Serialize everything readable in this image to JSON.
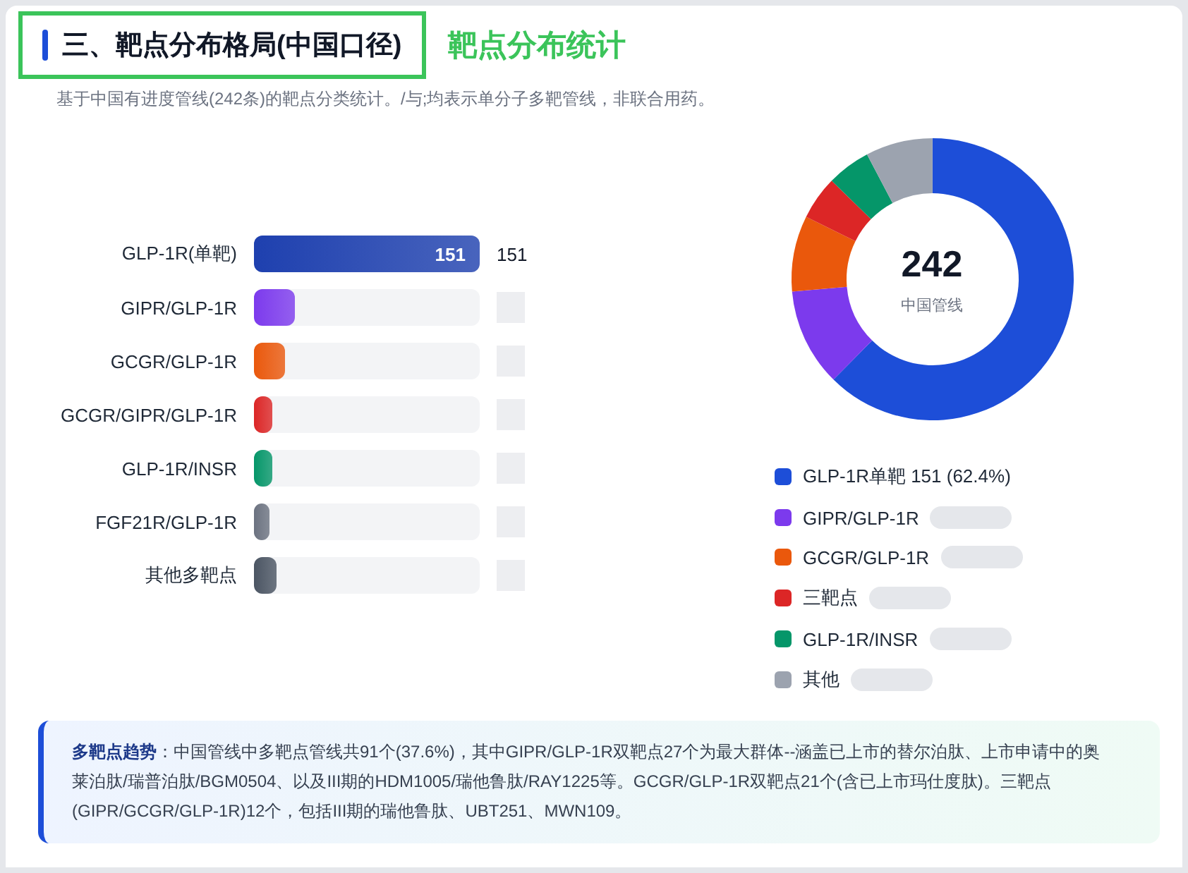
{
  "section": {
    "title": "三、靶点分布格局(中国口径)",
    "annotation": "靶点分布统计",
    "subtitle": "基于中国有进度管线(242条)的靶点分类统计。/与;均表示单分子多靶管线，非联合用药。"
  },
  "bars": [
    {
      "label": "GLP-1R(单靶)",
      "level": 1,
      "inner_value": "151",
      "value": "151",
      "color": "#1e40af"
    },
    {
      "label": "GIPR/GLP-1R",
      "level": 0.18,
      "color": "#7c3aed"
    },
    {
      "label": "GCGR/GLP-1R",
      "level": 0.14,
      "color": "#ea580c"
    },
    {
      "label": "GCGR/GIPR/GLP-1R",
      "level": 0.08,
      "color": "#dc2626"
    },
    {
      "label": "GLP-1R/INSR",
      "level": 0.08,
      "color": "#059669"
    },
    {
      "label": "FGF21R/GLP-1R",
      "level": 0.07,
      "color": "#6b7280"
    },
    {
      "label": "其他多靶点",
      "level": 0.1,
      "color": "#4b5563"
    }
  ],
  "donut": {
    "total": "242",
    "caption": "中国管线"
  },
  "legend": [
    {
      "label": "GLP-1R单靶 151 (62.4%)",
      "color": "#1d4ed8"
    },
    {
      "label": "GIPR/GLP-1R",
      "color": "#7c3aed"
    },
    {
      "label": "GCGR/GLP-1R",
      "color": "#ea580c"
    },
    {
      "label": "三靶点",
      "color": "#dc2626"
    },
    {
      "label": "GLP-1R/INSR",
      "color": "#059669"
    },
    {
      "label": "其他",
      "color": "#9ca3af"
    }
  ],
  "note": {
    "text": "**多靶点趋势**：中国管线中多靶点管线共91个(37.6%)，其中GIPR/GLP-1R双靶点27个为最大群体--涵盖已上市的替尔泊肽、上市申请中的奥莱泊肽/瑞普泊肽/BGM0504、以及III期的HDM1005/瑞他鲁肽/RAY1225等。GCGR/GLP-1R双靶点21个(含已上市玛仕度肽)。三靶点(GIPR/GCGR/GLP-1R)12个，包括III期的瑞他鲁肽、UBT251、MWN109。"
  }
}
